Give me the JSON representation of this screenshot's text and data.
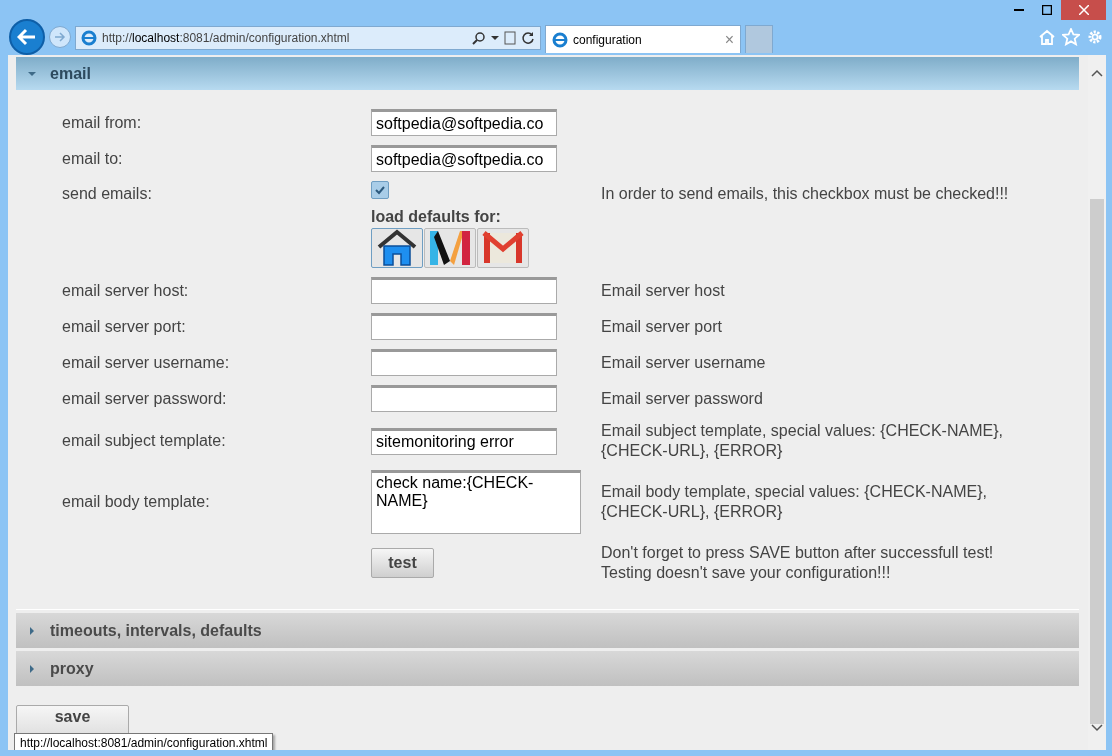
{
  "browser": {
    "address": "http://**localhost**:8081/admin/configuration.xhtml",
    "tab": {
      "title": "configuration",
      "close": "×"
    }
  },
  "sections": [
    {
      "title": "email",
      "expanded": true,
      "rows": [
        {
          "kind": "text",
          "label": "email from:",
          "value": "softpedia@softpedia.co"
        },
        {
          "kind": "text",
          "label": "email to:",
          "value": "softpedia@softpedia.co"
        },
        {
          "kind": "checkbox",
          "label": "send emails:",
          "checked": true,
          "help": "In order to send emails, this checkbox must be checked!!!"
        },
        {
          "kind": "presets",
          "title": "load defaults for:"
        },
        {
          "kind": "text",
          "label": "email server host:",
          "value": "",
          "help": "Email server host"
        },
        {
          "kind": "text",
          "label": "email server port:",
          "value": "",
          "help": "Email server port"
        },
        {
          "kind": "text",
          "label": "email server username:",
          "value": "",
          "help": "Email server username"
        },
        {
          "kind": "text",
          "label": "email server password:",
          "value": "",
          "help": "Email server password"
        },
        {
          "kind": "text",
          "label": "email subject template:",
          "value": "sitemonitoring error",
          "help": "Email subject template, special values: {CHECK-NAME}, {CHECK-URL}, {ERROR}"
        },
        {
          "kind": "textarea",
          "label": "email body template:",
          "value": "check name:{CHECK-NAME}",
          "help": "Email body template, special values: {CHECK-NAME}, {CHECK-URL}, {ERROR}"
        },
        {
          "kind": "button",
          "label": "test",
          "help": "Don't forget to press SAVE button after successfull test! Testing doesn't save your configuration!!!"
        }
      ]
    },
    {
      "title": "timeouts, intervals, defaults",
      "expanded": false
    },
    {
      "title": "proxy",
      "expanded": false
    }
  ],
  "save_button": "save",
  "status_tooltip": "http://localhost:8081/admin/configuration.xhtml"
}
